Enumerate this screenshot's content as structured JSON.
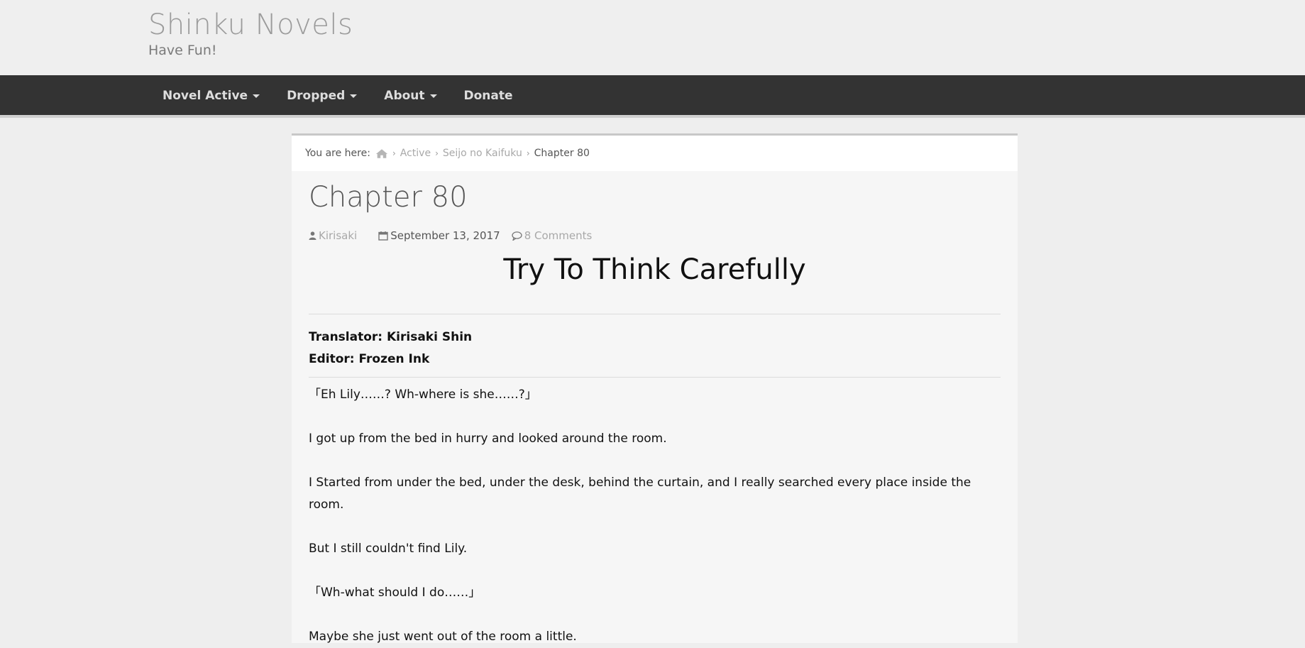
{
  "site": {
    "title": "Shinku Novels",
    "tagline": "Have Fun!"
  },
  "nav": {
    "items": [
      {
        "label": "Novel Active",
        "dropdown": true
      },
      {
        "label": "Dropped",
        "dropdown": true
      },
      {
        "label": "About",
        "dropdown": true
      },
      {
        "label": "Donate",
        "dropdown": false
      }
    ]
  },
  "breadcrumb": {
    "prefix": "You are here:",
    "home_icon": "home-icon",
    "crumbs": [
      "Active",
      "Seijo no Kaifuku"
    ],
    "current": "Chapter 80"
  },
  "post": {
    "title": "Chapter 80",
    "author": "Kirisaki",
    "date": "September 13, 2017",
    "comments": "8 Comments",
    "subtitle": "Try To Think Carefully",
    "translator": "Translator: Kirisaki Shin",
    "editor": "Editor: Frozen Ink",
    "paragraphs": [
      "「Eh Lily……?  Wh-where is she……?」",
      "I got up from the bed in hurry and looked around the room.",
      "I Started from under the bed, under the desk, behind the curtain, and I really searched every place inside the room.",
      "But I still couldn't find Lily.",
      "「Wh-what should I do……」",
      "Maybe she just went out of the room a little."
    ]
  },
  "colors": {
    "navbar": "#333333",
    "link_muted": "#a8a8a8"
  }
}
